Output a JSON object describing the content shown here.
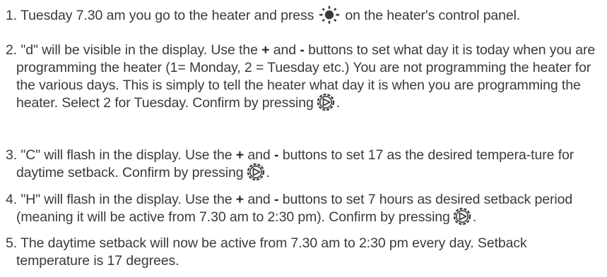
{
  "steps": [
    {
      "num": "1.",
      "t1": "Tuesday 7.30 am you go to the heater and press",
      "icon": "sun-icon",
      "t2": "on the heater's control panel."
    },
    {
      "num": "2.",
      "t1": "\"d\" will be visible in the display. Use the",
      "plus": "+",
      "and": "and",
      "minus": "-",
      "t2": "buttons to set what day it is today when you are programming the heater (1= Monday, 2 = Tuesday etc.) You are not programming the heater for the various days. This is simply to tell the heater what day it is when you are programming the heater. Select 2 for Tuesday. Confirm by pressing",
      "icon": "gear-icon",
      "end": "."
    },
    {
      "num": "3.",
      "t1": "\"C\" will flash in the display. Use the",
      "plus": "+",
      "and": "and",
      "minus": "-",
      "t2": "buttons to set 17 as the desired tempera-ture for daytime setback. Confirm by pressing",
      "icon": "gear-icon",
      "end": "."
    },
    {
      "num": "4.",
      "t1": "\"H\" will flash in the display. Use the",
      "plus": "+",
      "and": "and",
      "minus": "-",
      "t2": "buttons to set 7 hours as desired setback period (meaning it will be active from 7.30 am to 2:30 pm). Confirm by pressing",
      "icon": "gear-icon",
      "end": "."
    },
    {
      "num": "5.",
      "t1": "The daytime setback will now be active from 7.30 am to 2:30 pm every day. Setback temperature is 17 degrees."
    }
  ]
}
